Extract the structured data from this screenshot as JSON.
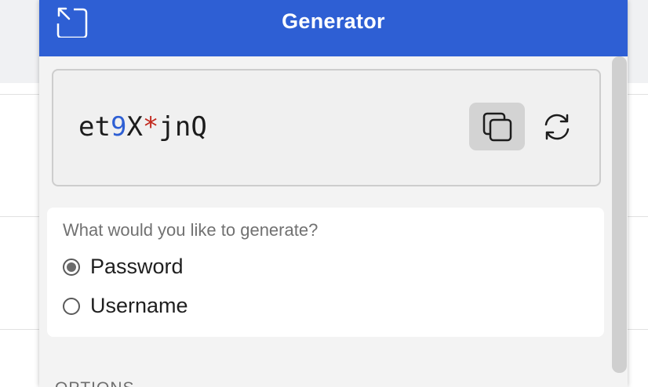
{
  "header": {
    "title": "Generator",
    "popout_icon": "popout-icon"
  },
  "password": {
    "letters_1": "et",
    "number_1": "9",
    "letters_2": "X",
    "symbol_1": "*",
    "letters_3": "jnQ"
  },
  "actions": {
    "copy_icon": "copy-icon",
    "regenerate_icon": "refresh-icon"
  },
  "generate_type": {
    "question": "What would you like to generate?",
    "options": [
      {
        "label": "Password",
        "selected": true
      },
      {
        "label": "Username",
        "selected": false
      }
    ]
  },
  "options_section": {
    "label": "OPTIONS"
  },
  "colors": {
    "header_bg": "#2e5fd4",
    "number_color": "#2e5fd4",
    "symbol_color": "#c2291e"
  }
}
